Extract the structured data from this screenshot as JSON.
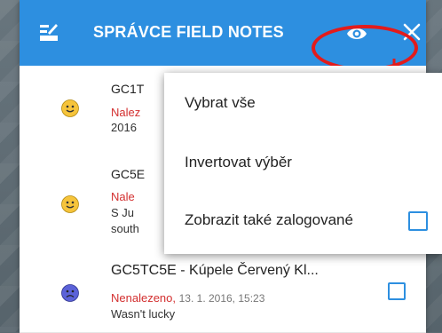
{
  "toolbar": {
    "title": "SPRÁVCE FIELD NOTES",
    "bg_color": "#2d8fe0",
    "logo_icon": "field-notes-icon",
    "eye_icon": "eye-icon",
    "close_icon": "close-icon"
  },
  "annotation": {
    "color": "#e31b1b"
  },
  "rows": [
    {
      "code": "GC1T",
      "status": "Nalez",
      "date": "",
      "note": "2016",
      "smiley": "happy"
    },
    {
      "code": "GC5E",
      "status": "Nale",
      "date": "",
      "note": "S Ju",
      "note2": "south",
      "smiley": "happy"
    },
    {
      "code": "GC5TC5E - Kúpele Červený Kl...",
      "status": "Nenalezeno,",
      "date": "13. 1. 2016, 15:23",
      "note": "Wasn't lucky",
      "smiley": "sad"
    }
  ],
  "menu": {
    "select_all": "Vybrat vše",
    "invert": "Invertovat výběr",
    "show_logged": "Zobrazit také zalogované"
  }
}
